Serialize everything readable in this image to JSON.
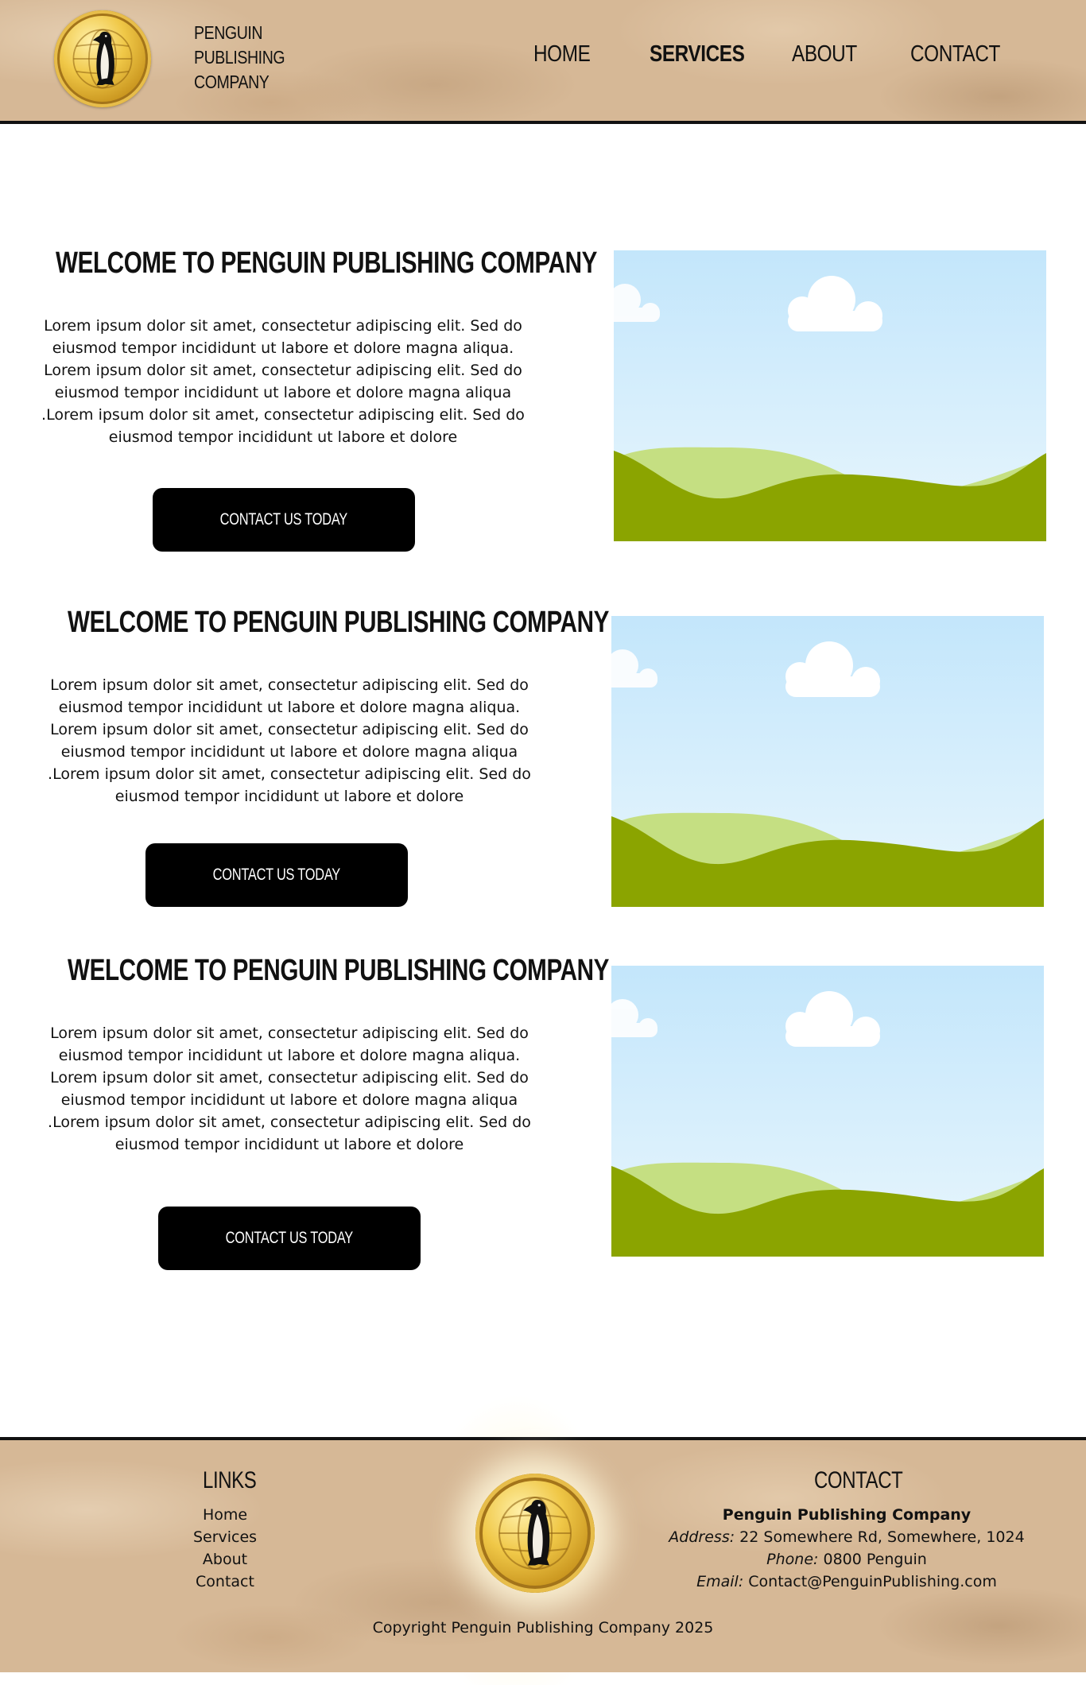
{
  "header": {
    "brand_lines": [
      "PENGUIN",
      "PUBLISHING",
      "COMPANY"
    ],
    "logo_icon": "penguin-globe-logo",
    "nav": [
      {
        "label": "HOME",
        "active": false
      },
      {
        "label": "SERVICES",
        "active": true
      },
      {
        "label": "ABOUT",
        "active": false
      },
      {
        "label": "CONTACT",
        "active": false
      }
    ]
  },
  "sections": [
    {
      "title": "WELCOME TO PENGUIN PUBLISHING COMPANY",
      "body_lines": [
        "Lorem ipsum dolor sit amet, consectetur adipiscing elit. Sed do",
        "eiusmod tempor incididunt ut labore et dolore magna aliqua.",
        "Lorem ipsum dolor sit amet, consectetur adipiscing elit. Sed do",
        "eiusmod tempor incididunt ut labore et dolore magna aliqua",
        ".Lorem ipsum dolor sit amet, consectetur adipiscing elit. Sed do",
        "eiusmod tempor incididunt ut labore et dolore"
      ],
      "cta_label": "CONTACT US TODAY",
      "image": "landscape-placeholder"
    },
    {
      "title": "WELCOME TO PENGUIN PUBLISHING COMPANY",
      "body_lines": [
        "Lorem ipsum dolor sit amet, consectetur adipiscing elit. Sed do",
        "eiusmod tempor incididunt ut labore et dolore magna aliqua.",
        "Lorem ipsum dolor sit amet, consectetur adipiscing elit. Sed do",
        "eiusmod tempor incididunt ut labore et dolore magna aliqua",
        ".Lorem ipsum dolor sit amet, consectetur adipiscing elit. Sed do",
        "eiusmod tempor incididunt ut labore et dolore"
      ],
      "cta_label": "CONTACT US TODAY",
      "image": "landscape-placeholder"
    },
    {
      "title": "WELCOME TO PENGUIN PUBLISHING COMPANY",
      "body_lines": [
        "Lorem ipsum dolor sit amet, consectetur adipiscing elit. Sed do",
        "eiusmod tempor incididunt ut labore et dolore magna aliqua.",
        "Lorem ipsum dolor sit amet, consectetur adipiscing elit. Sed do",
        "eiusmod tempor incididunt ut labore et dolore magna aliqua",
        ".Lorem ipsum dolor sit amet, consectetur adipiscing elit. Sed do",
        "eiusmod tempor incididunt ut labore et dolore"
      ],
      "cta_label": "CONTACT US TODAY",
      "image": "landscape-placeholder"
    }
  ],
  "footer": {
    "links_heading": "LINKS",
    "links": [
      "Home",
      "Services",
      "About",
      "Contact"
    ],
    "contact_heading": "CONTACT",
    "company": "Penguin Publishing Company",
    "address_label": "Address:",
    "address": "22 Somewhere Rd, Somewhere, 1024",
    "phone_label": "Phone:",
    "phone": "0800 Penguin",
    "email_label": "Email:",
    "email": "Contact@PenguinPublishing.com",
    "copyright": "Copyright Penguin Publishing Company 2025"
  },
  "colors": {
    "parchment": "#d6b896",
    "button": "#000000",
    "sky_top": "#c3e6fb",
    "sky_bottom": "#e8f6fd",
    "hill_light": "#c5df82",
    "hill_dark": "#8ba400"
  }
}
